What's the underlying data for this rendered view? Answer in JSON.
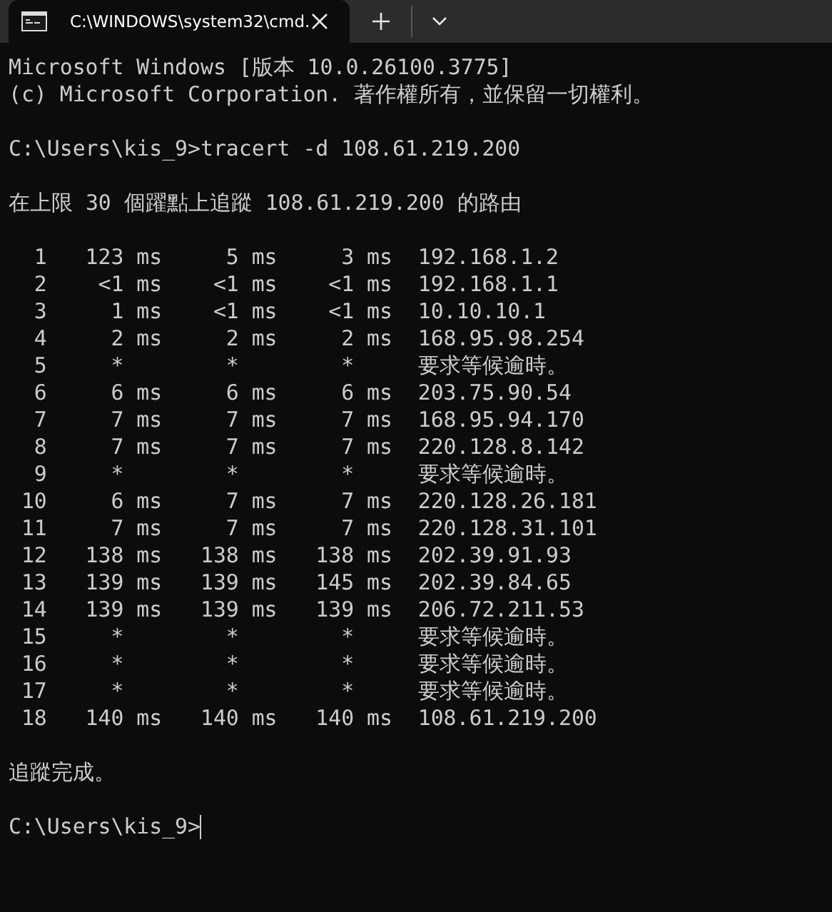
{
  "tab": {
    "title": "C:\\WINDOWS\\system32\\cmd.",
    "selected": true
  },
  "terminal": {
    "blocks": [
      [
        "Microsoft Windows [版本 10.0.26100.3775]",
        "(c) Microsoft Corporation. 著作權所有，並保留一切權利。"
      ],
      [
        "C:\\Users\\kis_9>tracert -d 108.61.219.200"
      ],
      [
        "在上限 30 個躍點上追蹤 108.61.219.200 的路由"
      ],
      [
        "  1   123 ms     5 ms     3 ms  192.168.1.2",
        "  2    <1 ms    <1 ms    <1 ms  192.168.1.1",
        "  3     1 ms    <1 ms    <1 ms  10.10.10.1",
        "  4     2 ms     2 ms     2 ms  168.95.98.254",
        "  5     *        *        *     要求等候逾時。",
        "  6     6 ms     6 ms     6 ms  203.75.90.54",
        "  7     7 ms     7 ms     7 ms  168.95.94.170",
        "  8     7 ms     7 ms     7 ms  220.128.8.142",
        "  9     *        *        *     要求等候逾時。",
        " 10     6 ms     7 ms     7 ms  220.128.26.181",
        " 11     7 ms     7 ms     7 ms  220.128.31.101",
        " 12   138 ms   138 ms   138 ms  202.39.91.93",
        " 13   139 ms   139 ms   145 ms  202.39.84.65",
        " 14   139 ms   139 ms   139 ms  206.72.211.53",
        " 15     *        *        *     要求等候逾時。",
        " 16     *        *        *     要求等候逾時。",
        " 17     *        *        *     要求等候逾時。",
        " 18   140 ms   140 ms   140 ms  108.61.219.200"
      ],
      [
        "追蹤完成。"
      ]
    ],
    "prompt": "C:\\Users\\kis_9>"
  }
}
